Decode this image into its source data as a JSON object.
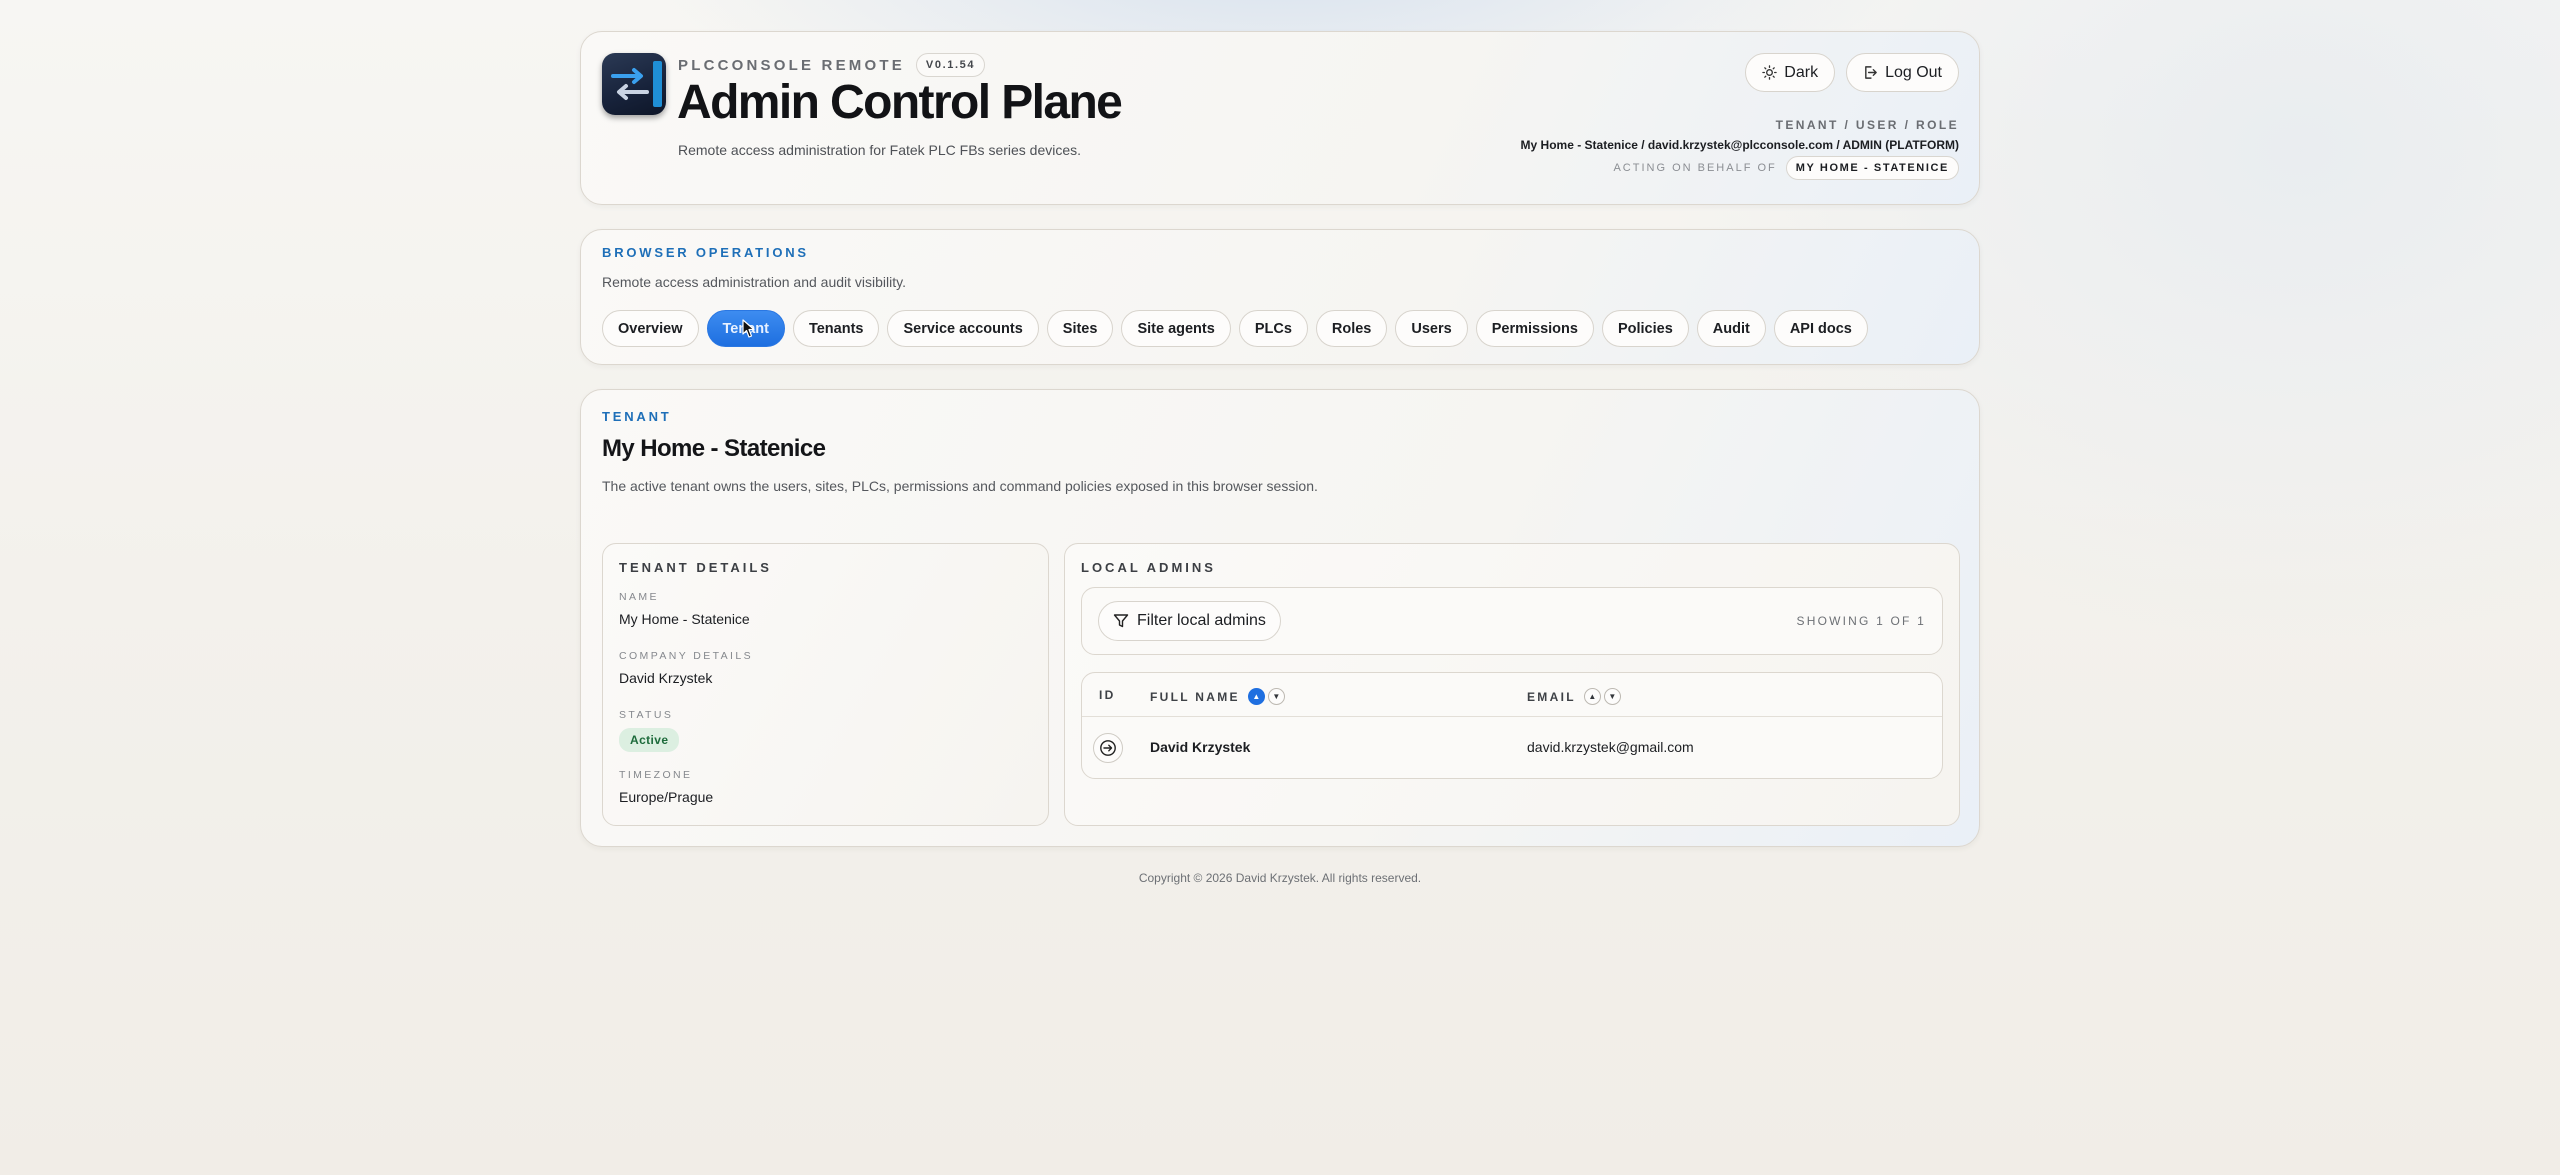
{
  "header": {
    "brand": "PLCCONSOLE REMOTE",
    "version": "V0.1.54",
    "title": "Admin Control Plane",
    "subtitle": "Remote access administration for Fatek PLC FBs series devices.",
    "theme_button": "Dark",
    "logout_button": "Log Out",
    "context_label": "TENANT / USER / ROLE",
    "context_value": "My Home - Statenice / david.krzystek@plcconsole.com / ADMIN (PLATFORM)",
    "behalf_label": "ACTING ON BEHALF OF",
    "behalf_value": "MY HOME - STATENICE"
  },
  "ops": {
    "kicker": "BROWSER OPERATIONS",
    "subtitle": "Remote access administration and audit visibility.",
    "tabs": [
      {
        "label": "Overview"
      },
      {
        "label": "Tenant",
        "active": true
      },
      {
        "label": "Tenants"
      },
      {
        "label": "Service accounts"
      },
      {
        "label": "Sites"
      },
      {
        "label": "Site agents"
      },
      {
        "label": "PLCs"
      },
      {
        "label": "Roles"
      },
      {
        "label": "Users"
      },
      {
        "label": "Permissions"
      },
      {
        "label": "Policies"
      },
      {
        "label": "Audit"
      },
      {
        "label": "API docs"
      }
    ]
  },
  "tenant": {
    "kicker": "TENANT",
    "title": "My Home - Statenice",
    "description": "The active tenant owns the users, sites, PLCs, permissions and command policies exposed in this browser session.",
    "details": {
      "heading": "TENANT DETAILS",
      "name_label": "NAME",
      "name_value": "My Home - Statenice",
      "company_label": "COMPANY DETAILS",
      "company_value": "David Krzystek",
      "status_label": "STATUS",
      "status_value": "Active",
      "timezone_label": "TIMEZONE",
      "timezone_value": "Europe/Prague"
    },
    "admins": {
      "heading": "LOCAL ADMINS",
      "filter_button": "Filter local admins",
      "showing": "SHOWING 1 OF 1",
      "columns": {
        "id": "ID",
        "full_name": "FULL NAME",
        "email": "EMAIL"
      },
      "rows": [
        {
          "full_name": "David Krzystek",
          "email": "david.krzystek@gmail.com"
        }
      ]
    }
  },
  "footer": "Copyright © 2026 David Krzystek. All rights reserved.",
  "colors": {
    "accent": "#1e6fe0",
    "kicker": "#1e6fb8",
    "status_active_bg": "#dcefe1"
  }
}
